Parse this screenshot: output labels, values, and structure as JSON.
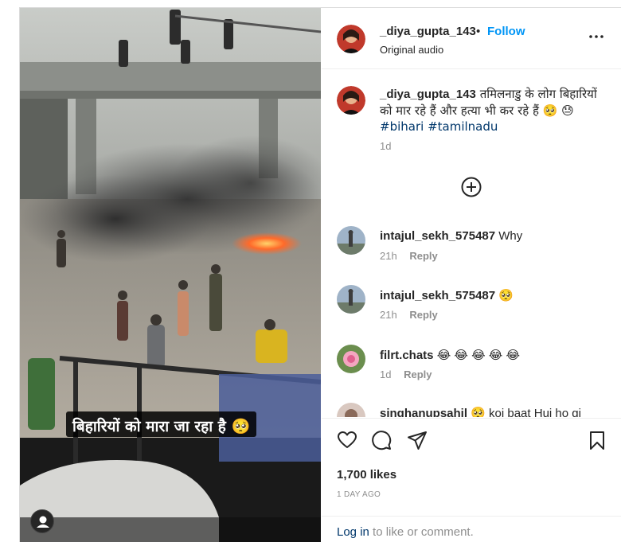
{
  "post": {
    "username": "_diya_gupta_143",
    "separator": "•",
    "follow_label": "Follow",
    "audio_label": "Original audio",
    "more_icon": "more-horizontal-icon",
    "video_caption": "बिहारियों को मारा जा रहा है 🥺",
    "user_tag_icon": "user-tag-icon"
  },
  "caption": {
    "username": "_diya_gupta_143",
    "text": "तमिलनाडु के लोग बिहारियों को मार रहे हैं और हत्या भी कर रहे हैं 🥺 😓",
    "hashtag1": "#bihari",
    "hashtag2": "#tamilnadu",
    "time": "1d",
    "load_more_icon": "plus-circle-icon"
  },
  "comments": [
    {
      "username": "intajul_sekh_575487",
      "text": "Why",
      "time": "21h",
      "reply": "Reply"
    },
    {
      "username": "intajul_sekh_575487",
      "text": "🥺",
      "time": "21h",
      "reply": "Reply"
    },
    {
      "username": "filrt.chats",
      "text": "😂 😂 😂 😂 😂",
      "time": "1d",
      "reply": "Reply"
    },
    {
      "username": "singhanupsahil",
      "text": "🥺 koi baat Hui ho gi",
      "time": "",
      "reply": ""
    }
  ],
  "actions": {
    "like_icon": "heart-icon",
    "comment_icon": "comment-icon",
    "share_icon": "share-icon",
    "save_icon": "bookmark-icon",
    "likes": "1,700 likes",
    "date": "1 DAY AGO",
    "login_link": "Log in",
    "login_suffix": " to like or comment."
  },
  "colors": {
    "accent": "#0095f6",
    "link": "#00376b",
    "muted": "#8e8e8e",
    "text": "#262626"
  }
}
